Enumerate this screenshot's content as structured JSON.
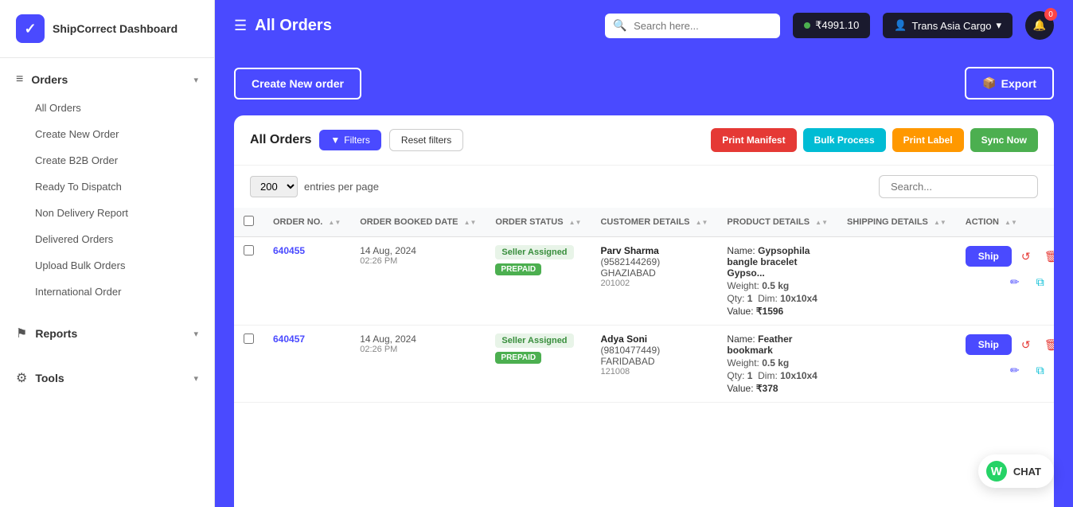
{
  "app": {
    "name": "ShipCorrect Dashboard"
  },
  "header": {
    "title": "All Orders",
    "search_placeholder": "Search here...",
    "wallet_amount": "₹4991.10",
    "user_name": "Trans Asia Cargo",
    "notification_count": "0"
  },
  "sidebar": {
    "logo_text": "ShipCorrect Dashboard",
    "sections": [
      {
        "id": "orders",
        "label": "Orders",
        "items": [
          {
            "id": "all-orders",
            "label": "All Orders",
            "active": true
          },
          {
            "id": "create-new-order",
            "label": "Create New Order"
          },
          {
            "id": "create-b2b-order",
            "label": "Create B2B Order"
          },
          {
            "id": "ready-to-dispatch",
            "label": "Ready To Dispatch"
          },
          {
            "id": "non-delivery-report",
            "label": "Non Delivery Report"
          },
          {
            "id": "delivered-orders",
            "label": "Delivered Orders"
          },
          {
            "id": "upload-bulk-orders",
            "label": "Upload Bulk Orders"
          },
          {
            "id": "international-order",
            "label": "International Order"
          }
        ]
      },
      {
        "id": "reports",
        "label": "Reports",
        "items": []
      },
      {
        "id": "tools",
        "label": "Tools",
        "items": []
      }
    ]
  },
  "page": {
    "create_order_label": "Create New order",
    "export_label": "Export"
  },
  "orders_table": {
    "title": "All Orders",
    "filter_label": "Filters",
    "reset_filter_label": "Reset filters",
    "print_manifest_label": "Print Manifest",
    "bulk_process_label": "Bulk Process",
    "print_label_label": "Print Label",
    "sync_now_label": "Sync Now",
    "entries_label": "entries per page",
    "entries_value": "200",
    "search_placeholder": "Search...",
    "columns": [
      {
        "id": "checkbox",
        "label": ""
      },
      {
        "id": "order_no",
        "label": "ORDER NO."
      },
      {
        "id": "order_booked_date",
        "label": "ORDER BOOKED DATE"
      },
      {
        "id": "order_status",
        "label": "ORDER STATUS"
      },
      {
        "id": "customer_details",
        "label": "CUSTOMER DETAILS"
      },
      {
        "id": "product_details",
        "label": "PRODUCT DETAILS"
      },
      {
        "id": "shipping_details",
        "label": "SHIPPING DETAILS"
      },
      {
        "id": "action",
        "label": "ACTION"
      }
    ],
    "rows": [
      {
        "order_no": "640455",
        "date": "14 Aug, 2024",
        "time": "02:26 PM",
        "status": "Seller Assigned",
        "payment_type": "PREPAID",
        "customer_name": "Parv Sharma",
        "customer_phone": "(9582144269)",
        "customer_city": "GHAZIABAD",
        "customer_pin": "201002",
        "product_name": "Gypsophila bangle bracelet Gypso...",
        "product_weight": "0.5 kg",
        "product_qty": "1",
        "product_dim": "10x10x4",
        "product_value": "₹1596"
      },
      {
        "order_no": "640457",
        "date": "14 Aug, 2024",
        "time": "02:26 PM",
        "status": "Seller Assigned",
        "payment_type": "PREPAID",
        "customer_name": "Adya Soni",
        "customer_phone": "(9810477449)",
        "customer_city": "FARIDABAD",
        "customer_pin": "121008",
        "product_name": "Feather bookmark",
        "product_weight": "0.5 kg",
        "product_qty": "1",
        "product_dim": "10x10x4",
        "product_value": "₹378"
      }
    ]
  },
  "chat_widget": {
    "label": "CHAT"
  },
  "icons": {
    "hamburger": "☰",
    "chevron_down": "▾",
    "search": "🔍",
    "wallet": "💳",
    "user": "👤",
    "bell": "🔔",
    "filter": "⊞",
    "reset": "↺",
    "ship_icon": "🚀",
    "undo": "↺",
    "delete": "🗑",
    "edit": "✏",
    "copy": "⧉",
    "export_icon": "📦",
    "whatsapp": "W",
    "orders_icon": "≡",
    "reports_icon": "⚑",
    "tools_icon": "⚙"
  }
}
